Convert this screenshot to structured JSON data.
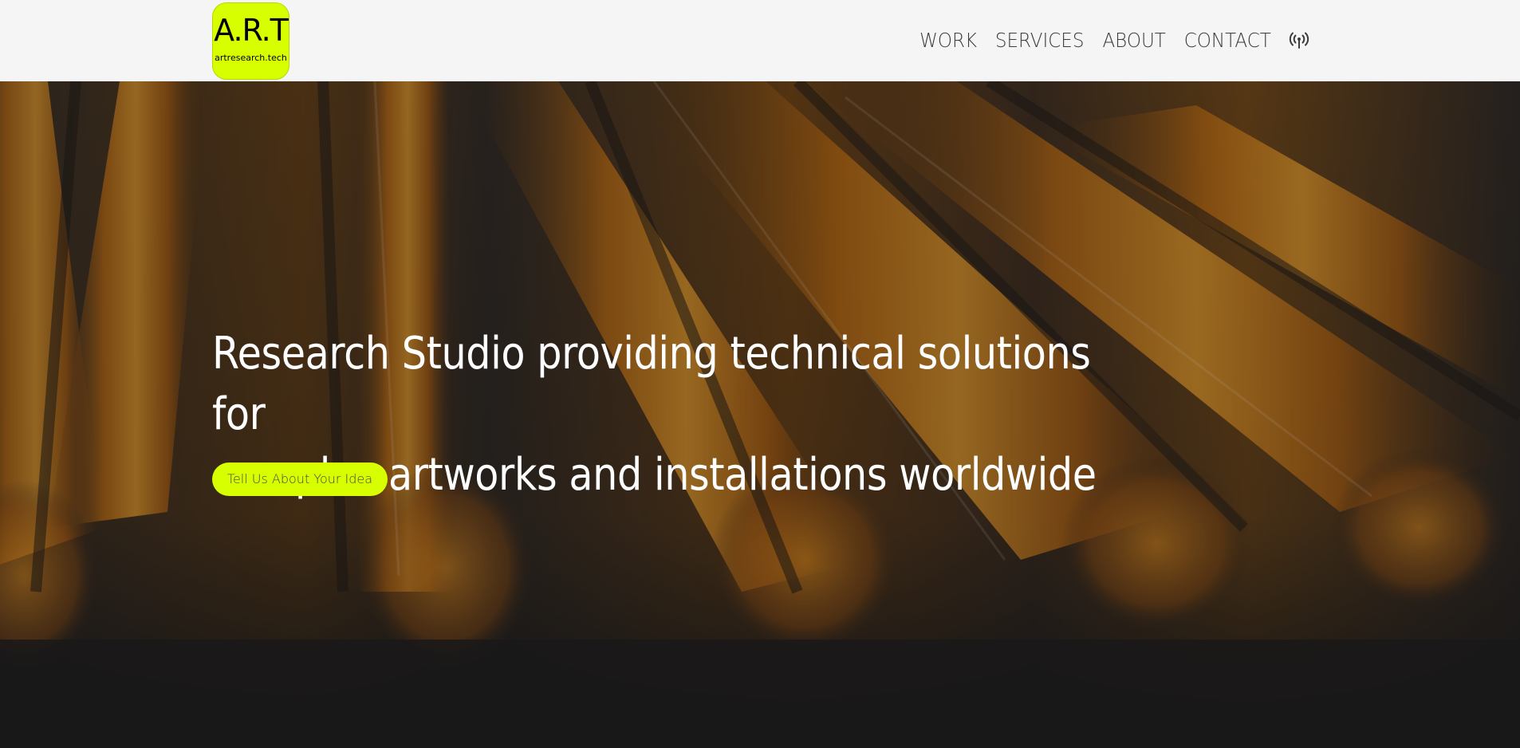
{
  "logo": {
    "main": "A.R.T",
    "sub": "artresearch.tech"
  },
  "nav": {
    "items": [
      {
        "label": "WORK"
      },
      {
        "label": "SERVICES"
      },
      {
        "label": "ABOUT"
      },
      {
        "label": "CONTACT"
      }
    ],
    "icon": "broadcast-antenna-icon"
  },
  "hero": {
    "headline_line1": "Research Studio providing technical solutions for",
    "headline_line2": "complex artworks and installations worldwide",
    "cta_label": "Tell Us About Your Idea",
    "background": "glowing-orange-glass-tubes-photo"
  },
  "colors": {
    "accent": "#d8ff00",
    "navbar_bg": "#f5f5f5",
    "nav_text": "#3c3c3c",
    "headline_text": "#ffffff"
  }
}
